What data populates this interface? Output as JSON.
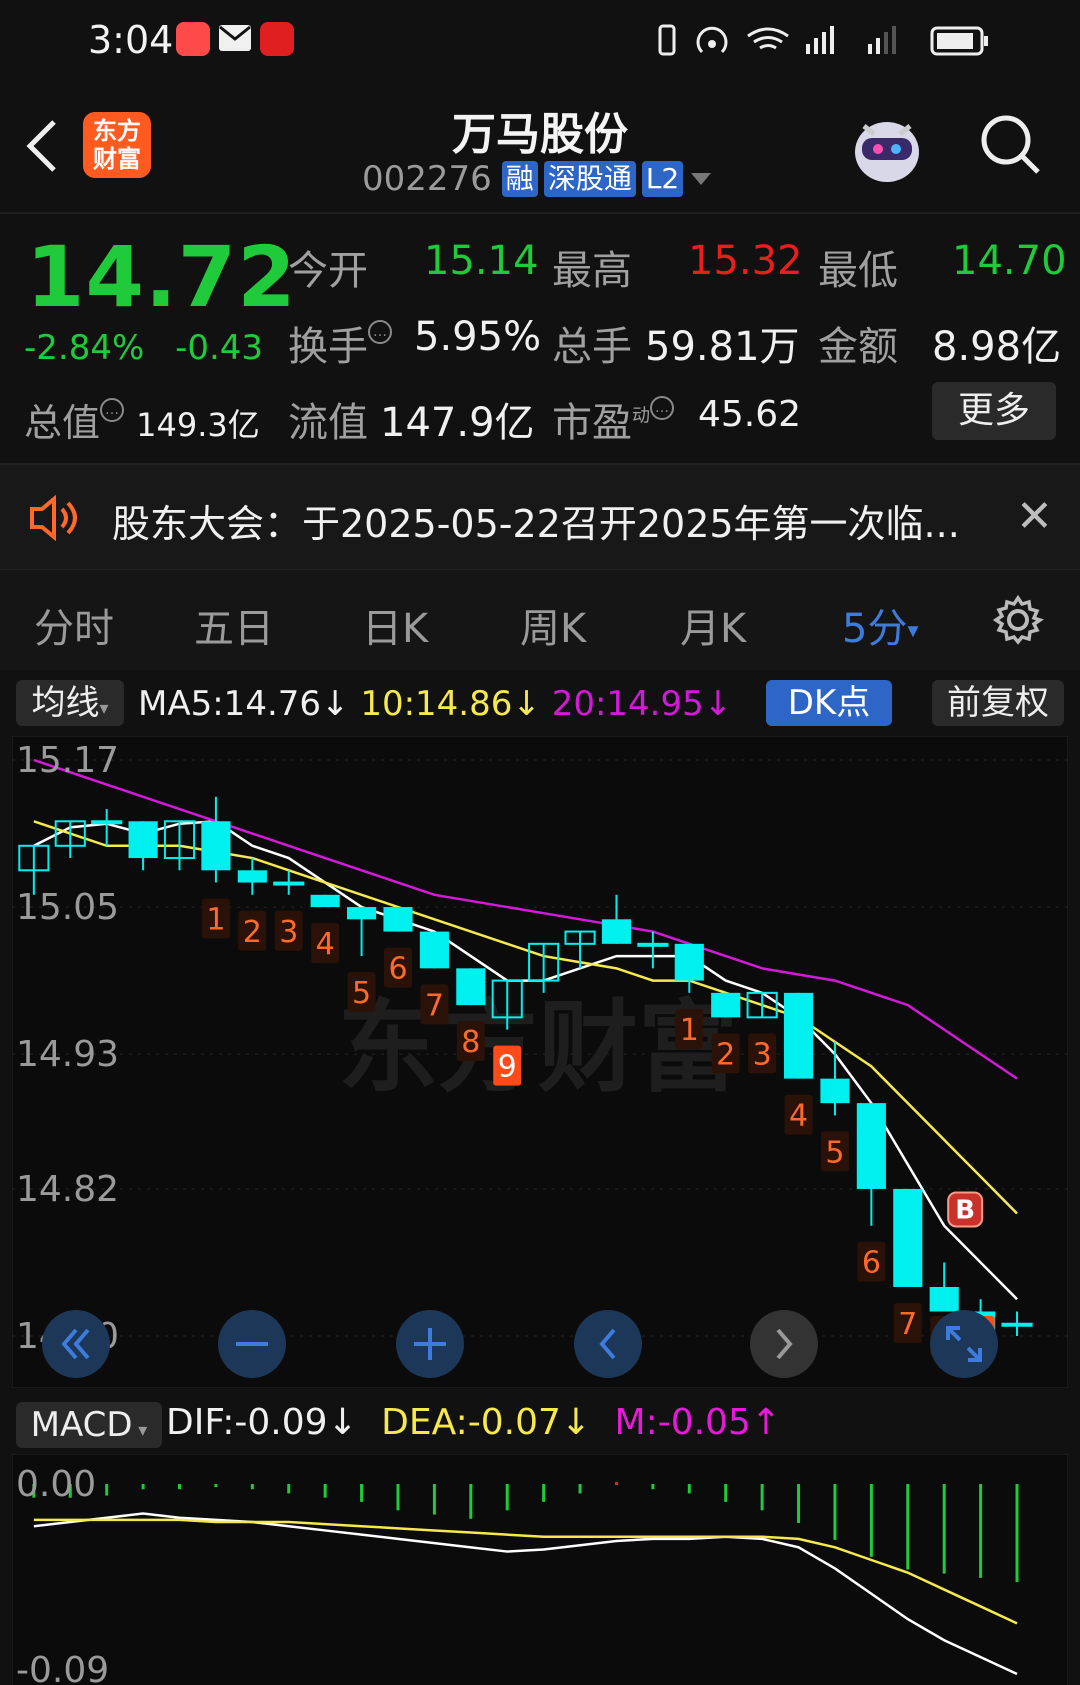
{
  "status_bar": {
    "time": "3:04"
  },
  "header": {
    "logo_line1": "东方",
    "logo_line2": "财富",
    "stock_name": "万马股份",
    "stock_code": "002276",
    "tags": [
      "融",
      "深股通",
      "L2"
    ]
  },
  "quote": {
    "price": "14.72",
    "change_pct": "-2.84%",
    "change_abs": "-0.43",
    "total_value_label": "总值",
    "total_value": "149.3亿",
    "fields": [
      {
        "label": "今开",
        "value": "15.14",
        "color": "green"
      },
      {
        "label": "最高",
        "value": "15.32",
        "color": "red"
      },
      {
        "label": "最低",
        "value": "14.70",
        "color": "green"
      },
      {
        "label": "换手",
        "value": "5.95%",
        "color": "white"
      },
      {
        "label": "总手",
        "value": "59.81万",
        "color": "white"
      },
      {
        "label": "金额",
        "value": "8.98亿",
        "color": "white"
      },
      {
        "label": "流值",
        "value": "147.9亿",
        "color": "white"
      },
      {
        "label": "市盈",
        "value": "45.62",
        "color": "white"
      }
    ],
    "pe_superscript": "动",
    "more_button": "更多"
  },
  "notice": {
    "text": "股东大会：于2025-05-22召开2025年第一次临..."
  },
  "tabs": [
    {
      "label": "分时",
      "active": false
    },
    {
      "label": "五日",
      "active": false
    },
    {
      "label": "日K",
      "active": false
    },
    {
      "label": "周K",
      "active": false
    },
    {
      "label": "月K",
      "active": false
    },
    {
      "label": "5分",
      "active": true
    }
  ],
  "chart_controls": {
    "indicator_select": "均线",
    "ma5": "MA5:14.76↓",
    "ma10": "10:14.86↓",
    "ma20": "20:14.95↓",
    "dk_button": "DK点",
    "adjust_button": "前复权"
  },
  "macd_controls": {
    "indicator_select": "MACD",
    "dif": "DIF:-0.09↓",
    "dea": "DEA:-0.07↓",
    "m": "M:-0.05↑"
  },
  "colors": {
    "up": "#ec1d1d",
    "down": "#1fcb3a",
    "candle_fill": "#00f0f0",
    "ma5": "#ffffff",
    "ma10": "#f5e94e",
    "ma20": "#d21ad8",
    "accent": "#3d7bdc"
  },
  "watermark": "东方财富",
  "chart_data": [
    {
      "type": "candlestick",
      "y_ticks": [
        "15.17",
        "15.05",
        "14.93",
        "14.82",
        "14.70"
      ],
      "ylim": [
        14.7,
        15.17
      ],
      "candles": [
        {
          "o": 15.08,
          "h": 15.1,
          "l": 15.06,
          "c": 15.1
        },
        {
          "o": 15.1,
          "h": 15.12,
          "l": 15.09,
          "c": 15.12
        },
        {
          "o": 15.12,
          "h": 15.13,
          "l": 15.1,
          "c": 15.12
        },
        {
          "o": 15.12,
          "h": 15.12,
          "l": 15.08,
          "c": 15.09
        },
        {
          "o": 15.09,
          "h": 15.12,
          "l": 15.08,
          "c": 15.12
        },
        {
          "o": 15.12,
          "h": 15.14,
          "l": 15.07,
          "c": 15.08
        },
        {
          "o": 15.08,
          "h": 15.09,
          "l": 15.06,
          "c": 15.07
        },
        {
          "o": 15.07,
          "h": 15.08,
          "l": 15.06,
          "c": 15.07
        },
        {
          "o": 15.06,
          "h": 15.06,
          "l": 15.05,
          "c": 15.05
        },
        {
          "o": 15.05,
          "h": 15.05,
          "l": 15.01,
          "c": 15.04
        },
        {
          "o": 15.05,
          "h": 15.05,
          "l": 15.03,
          "c": 15.03
        },
        {
          "o": 15.03,
          "h": 15.03,
          "l": 15.0,
          "c": 15.0
        },
        {
          "o": 15.0,
          "h": 15.0,
          "l": 14.97,
          "c": 14.97
        },
        {
          "o": 14.96,
          "h": 14.99,
          "l": 14.95,
          "c": 14.99
        },
        {
          "o": 14.99,
          "h": 15.02,
          "l": 14.98,
          "c": 15.02
        },
        {
          "o": 15.02,
          "h": 15.03,
          "l": 15.0,
          "c": 15.03
        },
        {
          "o": 15.04,
          "h": 15.06,
          "l": 15.02,
          "c": 15.02
        },
        {
          "o": 15.02,
          "h": 15.03,
          "l": 15.0,
          "c": 15.02
        },
        {
          "o": 15.02,
          "h": 15.02,
          "l": 14.98,
          "c": 14.99
        },
        {
          "o": 14.98,
          "h": 14.98,
          "l": 14.96,
          "c": 14.96
        },
        {
          "o": 14.96,
          "h": 14.98,
          "l": 14.96,
          "c": 14.98
        },
        {
          "o": 14.98,
          "h": 14.98,
          "l": 14.91,
          "c": 14.91
        },
        {
          "o": 14.91,
          "h": 14.94,
          "l": 14.88,
          "c": 14.89
        },
        {
          "o": 14.89,
          "h": 14.89,
          "l": 14.79,
          "c": 14.82
        },
        {
          "o": 14.82,
          "h": 14.82,
          "l": 14.74,
          "c": 14.74
        },
        {
          "o": 14.74,
          "h": 14.76,
          "l": 14.72,
          "c": 14.72
        },
        {
          "o": 14.72,
          "h": 14.73,
          "l": 14.69,
          "c": 14.7
        },
        {
          "o": 14.71,
          "h": 14.72,
          "l": 14.7,
          "c": 14.71
        }
      ],
      "series": [
        {
          "values": [
            15.1,
            15.115,
            15.118,
            15.11,
            15.118,
            15.12,
            15.1,
            15.09,
            15.07,
            15.05,
            15.04,
            15.03,
            15.01,
            14.99,
            14.99,
            15.0,
            15.01,
            15.01,
            15.01,
            14.99,
            14.98,
            14.96,
            14.93,
            14.89,
            14.84,
            14.79,
            14.76,
            14.73
          ]
        },
        {
          "values": [
            15.12,
            15.11,
            15.1,
            15.1,
            15.1,
            15.095,
            15.09,
            15.08,
            15.07,
            15.06,
            15.05,
            15.04,
            15.03,
            15.02,
            15.01,
            15.005,
            15.0,
            14.99,
            14.99,
            14.98,
            14.97,
            14.96,
            14.94,
            14.92,
            14.89,
            14.86,
            14.83,
            14.8
          ]
        },
        {
          "values": [
            15.17,
            15.16,
            15.15,
            15.14,
            15.13,
            15.12,
            15.11,
            15.1,
            15.09,
            15.08,
            15.07,
            15.06,
            15.055,
            15.05,
            15.045,
            15.04,
            15.035,
            15.03,
            15.02,
            15.01,
            15.0,
            14.995,
            14.99,
            14.98,
            14.97,
            14.95,
            14.93,
            14.91
          ]
        }
      ],
      "td_labels": [
        {
          "i": 5,
          "n": "1"
        },
        {
          "i": 6,
          "n": "2"
        },
        {
          "i": 7,
          "n": "3"
        },
        {
          "i": 8,
          "n": "4"
        },
        {
          "i": 9,
          "n": "5"
        },
        {
          "i": 10,
          "n": "6"
        },
        {
          "i": 11,
          "n": "7"
        },
        {
          "i": 12,
          "n": "8"
        },
        {
          "i": 13,
          "n": "9"
        },
        {
          "i": 18,
          "n": "1"
        },
        {
          "i": 19,
          "n": "2"
        },
        {
          "i": 20,
          "n": "3"
        },
        {
          "i": 21,
          "n": "4"
        },
        {
          "i": 22,
          "n": "5"
        },
        {
          "i": 23,
          "n": "6"
        },
        {
          "i": 24,
          "n": "7"
        },
        {
          "i": 25,
          "n": "8"
        },
        {
          "i": 26,
          "n": "9"
        }
      ],
      "buy_marker": "B"
    },
    {
      "type": "bar+line",
      "y_ticks": [
        "0.00",
        "-0.09"
      ],
      "ylim": [
        -0.09,
        0.0
      ],
      "bars": [
        -0.006,
        -0.006,
        -0.005,
        -0.002,
        -0.002,
        -0.001,
        -0.002,
        -0.004,
        -0.006,
        -0.008,
        -0.012,
        -0.014,
        -0.016,
        -0.012,
        -0.008,
        -0.004,
        0.001,
        -0.002,
        -0.004,
        -0.008,
        -0.012,
        -0.018,
        -0.026,
        -0.034,
        -0.04,
        -0.042,
        -0.044,
        -0.046
      ],
      "series": [
        {
          "values": [
            -0.02,
            -0.018,
            -0.016,
            -0.014,
            -0.016,
            -0.017,
            -0.018,
            -0.02,
            -0.022,
            -0.024,
            -0.026,
            -0.028,
            -0.03,
            -0.032,
            -0.031,
            -0.029,
            -0.027,
            -0.026,
            -0.026,
            -0.025,
            -0.026,
            -0.03,
            -0.04,
            -0.052,
            -0.064,
            -0.074,
            -0.082,
            -0.09
          ]
        },
        {
          "values": [
            -0.017,
            -0.017,
            -0.017,
            -0.017,
            -0.017,
            -0.018,
            -0.018,
            -0.018,
            -0.019,
            -0.02,
            -0.021,
            -0.022,
            -0.023,
            -0.024,
            -0.025,
            -0.025,
            -0.025,
            -0.025,
            -0.025,
            -0.025,
            -0.025,
            -0.026,
            -0.03,
            -0.036,
            -0.042,
            -0.05,
            -0.058,
            -0.066
          ]
        }
      ]
    }
  ]
}
